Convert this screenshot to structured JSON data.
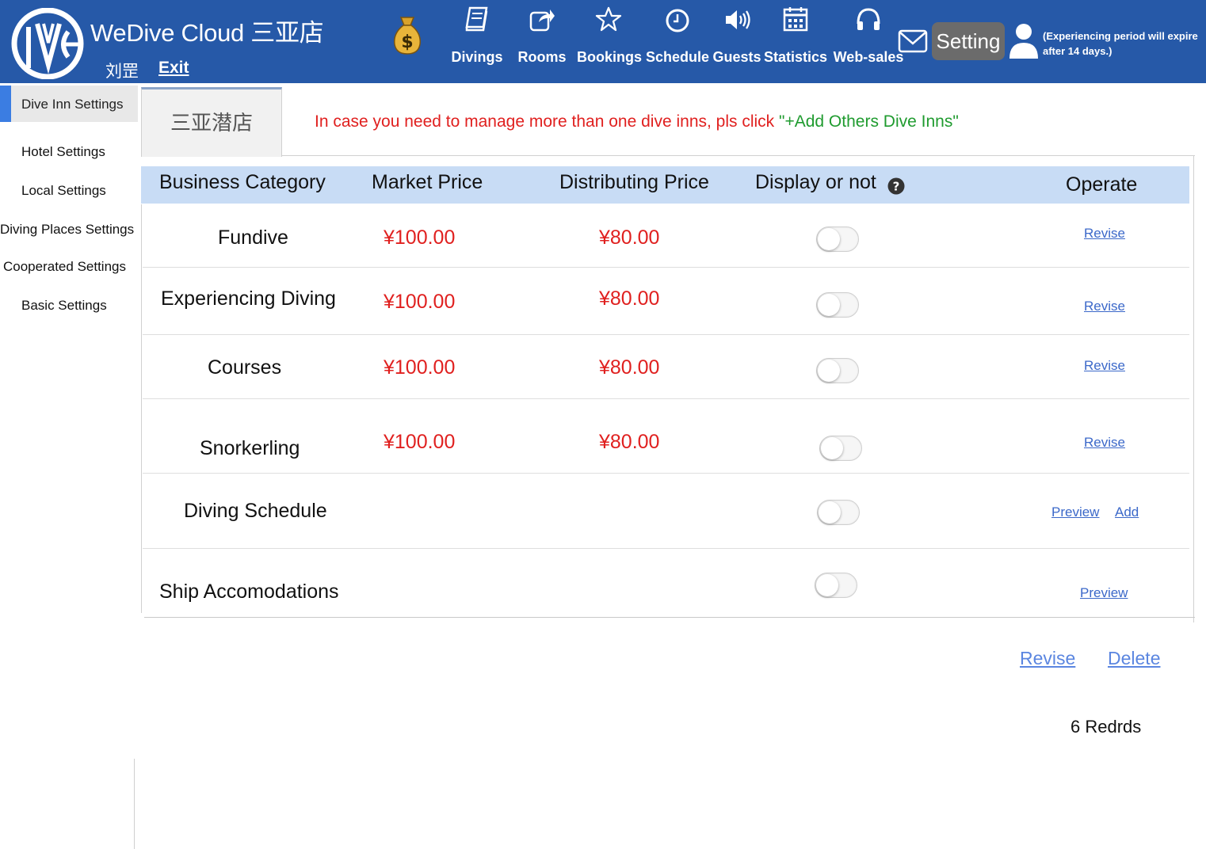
{
  "header": {
    "brand": "WeDive Cloud 三亚店",
    "user_name": "刘罡",
    "exit_label": "Exit",
    "nav": [
      {
        "label": "Divings",
        "icon": "book-icon"
      },
      {
        "label": "Rooms",
        "icon": "share-icon"
      },
      {
        "label": "Bookings",
        "icon": "star-icon"
      },
      {
        "label": "Schedule",
        "icon": "clock-icon"
      },
      {
        "label": "Guests",
        "icon": "volume-icon"
      },
      {
        "label": "Statistics",
        "icon": "calendar-icon"
      },
      {
        "label": "Web-sales",
        "icon": "headphones-icon"
      }
    ],
    "setting_label": "Setting",
    "expire_note": "(Experiencing period will expire after 14 days.)"
  },
  "sidebar": {
    "items": [
      {
        "label": "Dive Inn Settings",
        "active": true
      },
      {
        "label": "Hotel Settings"
      },
      {
        "label": "Local Settings"
      },
      {
        "label": "Diving Places Settings"
      },
      {
        "label": "Cooperated Settings"
      },
      {
        "label": "Basic Settings"
      }
    ]
  },
  "tab": {
    "shop_name": "三亚潜店"
  },
  "notice": {
    "text": "In case you need to manage more than one dive inns, pls click ",
    "link": "\"+Add Others Dive Inns\""
  },
  "table": {
    "headers": [
      "Business Category",
      "Market Price",
      "Distributing Price",
      "Display or not",
      "Operate"
    ],
    "rows": [
      {
        "category": "Fundive",
        "market_price": "¥100.00",
        "distributing_price": "¥80.00",
        "display": false,
        "ops": [
          "Revise"
        ]
      },
      {
        "category": "Experiencing Diving",
        "market_price": "¥100.00",
        "distributing_price": "¥80.00",
        "display": false,
        "ops": [
          "Revise"
        ]
      },
      {
        "category": "Courses",
        "market_price": "¥100.00",
        "distributing_price": "¥80.00",
        "display": false,
        "ops": [
          "Revise"
        ]
      },
      {
        "category": "Snorkerling",
        "market_price": "¥100.00",
        "distributing_price": "¥80.00",
        "display": false,
        "ops": [
          "Revise"
        ]
      },
      {
        "category": "Diving Schedule",
        "market_price": "",
        "distributing_price": "",
        "display": false,
        "ops": [
          "Preview",
          "Add"
        ]
      },
      {
        "category": "Ship Accomodations",
        "market_price": "",
        "distributing_price": "",
        "display": false,
        "ops": [
          "Preview"
        ]
      }
    ]
  },
  "footer": {
    "revise_label": "Revise",
    "delete_label": "Delete",
    "records": "6 Redrds"
  },
  "colors": {
    "header_bg": "#2659a8",
    "price": "#e0201f",
    "add_link": "#1f9b2f",
    "link": "#3b68c9",
    "table_head_bg": "#c8dcf5",
    "active_bar": "#3b7de2"
  }
}
